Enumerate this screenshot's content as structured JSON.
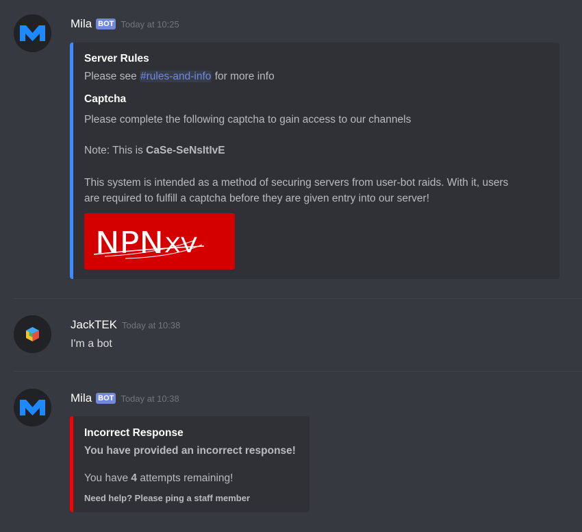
{
  "messages": [
    {
      "author": "Mila",
      "bot_tag": "BOT",
      "timestamp": "Today at 10:25",
      "avatar_icon": "mila-m-logo-icon",
      "embed": {
        "color": "#3b8cff",
        "field1_title": "Server Rules",
        "field1_prefix": "Please see ",
        "field1_mention": "#rules-and-info",
        "field1_suffix": " for more info",
        "field2_title": "Captcha",
        "field2_line1": "Please complete the following captcha to gain access to our channels",
        "field2_note_prefix": "Note: This is ",
        "field2_note_bold": "CaSe-SeNsItIvE",
        "field2_para_line1": "This system is intended as a method of securing servers from user-bot raids. With it, users",
        "field2_para_line2": "are required to fulfill a captcha before they are given entry into our server!",
        "captcha_text": "NPNXV"
      }
    },
    {
      "author": "JackTEK",
      "timestamp": "Today at 10:38",
      "avatar_icon": "colored-cube-icon",
      "content": "I'm a bot"
    },
    {
      "author": "Mila",
      "bot_tag": "BOT",
      "timestamp": "Today at 10:38",
      "avatar_icon": "mila-m-logo-icon",
      "embed": {
        "color": "#ff0000",
        "title": "Incorrect Response",
        "subtitle": "You have provided an incorrect response!",
        "attempts_prefix": "You have ",
        "attempts_count": "4",
        "attempts_suffix": " attempts remaining!",
        "footer": "Need help? Please ping a staff member"
      }
    }
  ]
}
